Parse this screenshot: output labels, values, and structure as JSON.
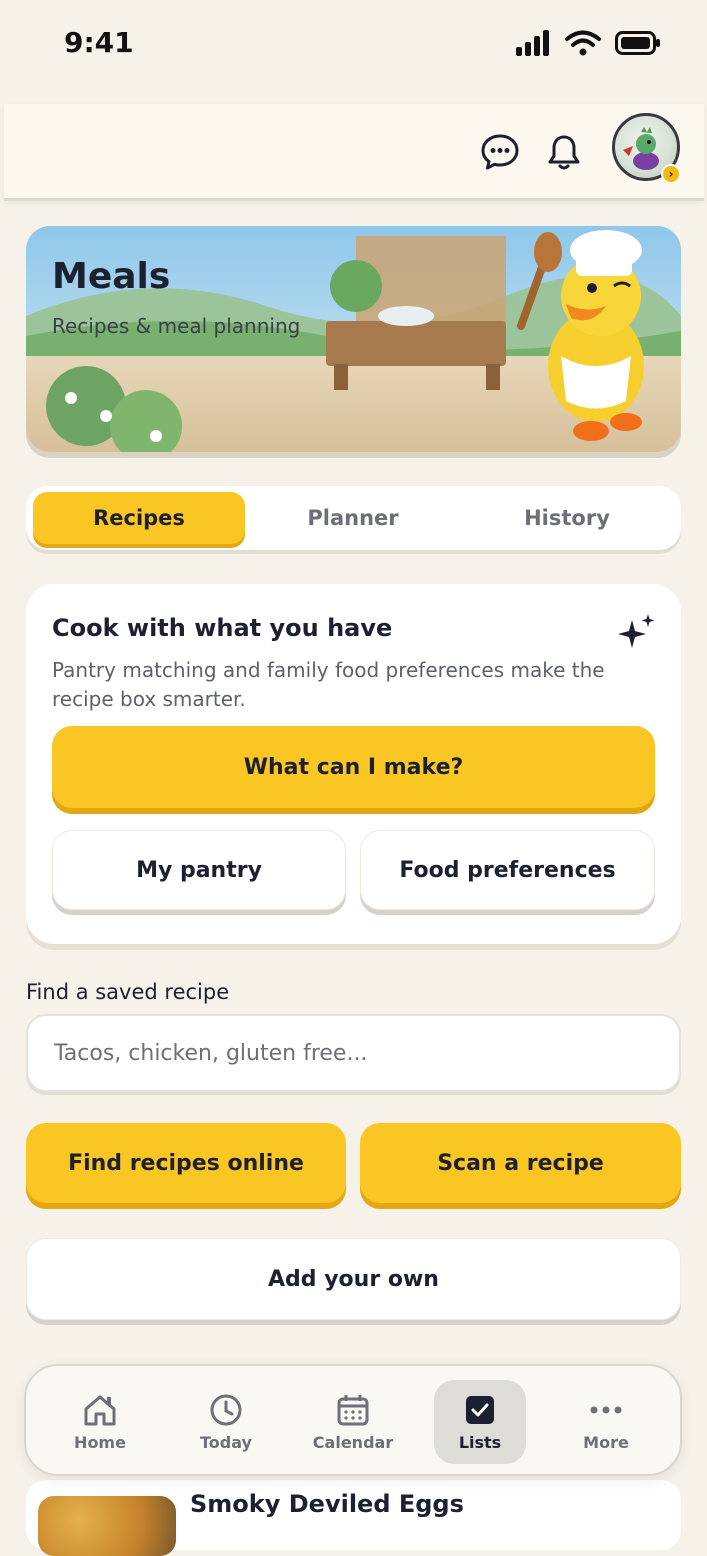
{
  "status_bar": {
    "time": "9:41"
  },
  "hero": {
    "title": "Meals",
    "subtitle": "Recipes & meal planning"
  },
  "tabs": [
    {
      "label": "Recipes",
      "active": true
    },
    {
      "label": "Planner",
      "active": false
    },
    {
      "label": "History",
      "active": false
    }
  ],
  "card": {
    "title": "Cook with what you have",
    "description": "Pantry matching and family food preferences make the recipe box smarter.",
    "primary_button": "What can I make?",
    "pantry_button": "My pantry",
    "preferences_button": "Food preferences"
  },
  "search": {
    "label": "Find a saved recipe",
    "placeholder": "Tacos, chicken, gluten free..."
  },
  "actions": {
    "find_online": "Find recipes online",
    "scan": "Scan a recipe",
    "add_own": "Add your own"
  },
  "recipe_preview": {
    "name": "Smoky Deviled Eggs"
  },
  "nav": {
    "items": [
      {
        "label": "Home",
        "icon": "home-icon",
        "active": false
      },
      {
        "label": "Today",
        "icon": "clock-icon",
        "active": false
      },
      {
        "label": "Calendar",
        "icon": "calendar-icon",
        "active": false
      },
      {
        "label": "Lists",
        "icon": "checkbox-icon",
        "active": true
      },
      {
        "label": "More",
        "icon": "more-icon",
        "active": false
      }
    ]
  },
  "colors": {
    "accent": "#f9c624",
    "accent_shadow": "#e3a712",
    "background": "#f6f2e9"
  }
}
